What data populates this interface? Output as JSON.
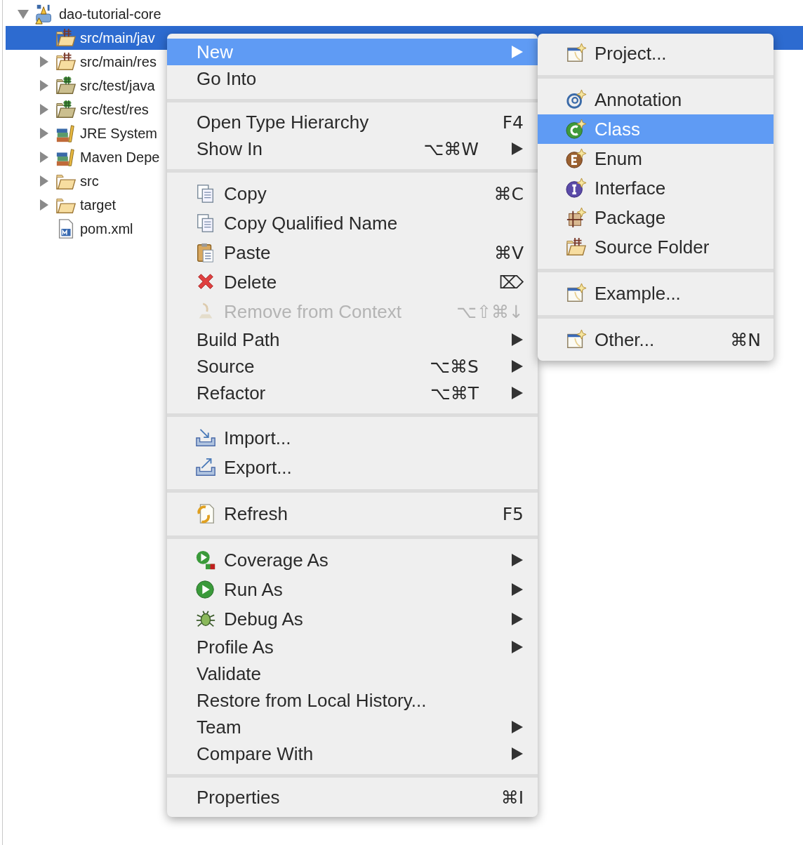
{
  "tree": {
    "label": "dao-tutorial-core",
    "kind": "project",
    "expanded": true,
    "selected": false,
    "children": [
      {
        "label": "src/main/jav",
        "kind": "sourcefolder",
        "selected": true
      },
      {
        "label": "src/main/res",
        "kind": "sourcefolder",
        "expanded": false,
        "selected": false
      },
      {
        "label": "src/test/java",
        "kind": "testfolder",
        "expanded": false,
        "selected": false
      },
      {
        "label": "src/test/res",
        "kind": "testfolder",
        "expanded": false,
        "selected": false
      },
      {
        "label": "JRE System",
        "kind": "library",
        "expanded": false,
        "selected": false
      },
      {
        "label": "Maven Depe",
        "kind": "library",
        "expanded": false,
        "selected": false
      },
      {
        "label": "src",
        "kind": "folder",
        "expanded": false,
        "selected": false
      },
      {
        "label": "target",
        "kind": "folder",
        "expanded": false,
        "selected": false
      },
      {
        "label": "pom.xml",
        "kind": "maven",
        "selected": false
      }
    ]
  },
  "context_menu": {
    "groups": [
      [
        {
          "label": "New",
          "kind": "plain",
          "submenu": true,
          "selected": true,
          "disabled": false
        },
        {
          "label": "Go Into",
          "kind": "plain",
          "submenu": false,
          "selected": false,
          "disabled": false
        }
      ],
      [
        {
          "label": "Open Type Hierarchy",
          "shortcut": "F4",
          "kind": "plain",
          "submenu": false,
          "selected": false,
          "disabled": false
        },
        {
          "label": "Show In",
          "shortcut": "⌥⌘W",
          "kind": "plain",
          "submenu": true,
          "selected": false,
          "disabled": false
        }
      ],
      [
        {
          "label": "Copy",
          "shortcut": "⌘C",
          "kind": "copy",
          "submenu": false,
          "selected": false,
          "disabled": false
        },
        {
          "label": "Copy Qualified Name",
          "kind": "copy",
          "submenu": false,
          "selected": false,
          "disabled": false
        },
        {
          "label": "Paste",
          "shortcut": "⌘V",
          "kind": "paste",
          "submenu": false,
          "selected": false,
          "disabled": false
        },
        {
          "label": "Delete",
          "shortcut": "⌦",
          "kind": "delete",
          "submenu": false,
          "selected": false,
          "disabled": false
        },
        {
          "label": "Remove from Context",
          "shortcut": "⌥⇧⌘↓",
          "kind": "remove",
          "submenu": false,
          "selected": false,
          "disabled": true
        },
        {
          "label": "Build Path",
          "kind": "plain",
          "submenu": true,
          "selected": false,
          "disabled": false
        },
        {
          "label": "Source",
          "shortcut": "⌥⌘S",
          "kind": "plain",
          "submenu": true,
          "selected": false,
          "disabled": false
        },
        {
          "label": "Refactor",
          "shortcut": "⌥⌘T",
          "kind": "plain",
          "submenu": true,
          "selected": false,
          "disabled": false
        }
      ],
      [
        {
          "label": "Import...",
          "kind": "import",
          "submenu": false,
          "selected": false,
          "disabled": false
        },
        {
          "label": "Export...",
          "kind": "export",
          "submenu": false,
          "selected": false,
          "disabled": false
        }
      ],
      [
        {
          "label": "Refresh",
          "shortcut": "F5",
          "kind": "refresh",
          "submenu": false,
          "selected": false,
          "disabled": false
        }
      ],
      [
        {
          "label": "Coverage As",
          "kind": "coverage",
          "submenu": true,
          "selected": false,
          "disabled": false
        },
        {
          "label": "Run As",
          "kind": "run",
          "submenu": true,
          "selected": false,
          "disabled": false
        },
        {
          "label": "Debug As",
          "kind": "debug",
          "submenu": true,
          "selected": false,
          "disabled": false
        },
        {
          "label": "Profile As",
          "kind": "plain",
          "submenu": true,
          "selected": false,
          "disabled": false
        },
        {
          "label": "Validate",
          "kind": "plain",
          "submenu": false,
          "selected": false,
          "disabled": false
        },
        {
          "label": "Restore from Local History...",
          "kind": "plain",
          "submenu": false,
          "selected": false,
          "disabled": false
        },
        {
          "label": "Team",
          "kind": "plain",
          "submenu": true,
          "selected": false,
          "disabled": false
        },
        {
          "label": "Compare With",
          "kind": "plain",
          "submenu": true,
          "selected": false,
          "disabled": false
        }
      ],
      [
        {
          "label": "Properties",
          "shortcut": "⌘I",
          "kind": "plain",
          "submenu": false,
          "selected": false,
          "disabled": false
        }
      ]
    ]
  },
  "new_submenu": {
    "groups": [
      [
        {
          "label": "Project...",
          "kind": "wizard",
          "selected": false
        }
      ],
      [
        {
          "label": "Annotation",
          "kind": "annotation",
          "selected": false
        },
        {
          "label": "Class",
          "kind": "class",
          "selected": true
        },
        {
          "label": "Enum",
          "kind": "enum",
          "selected": false
        },
        {
          "label": "Interface",
          "kind": "interface",
          "selected": false
        },
        {
          "label": "Package",
          "kind": "package",
          "selected": false
        },
        {
          "label": "Source Folder",
          "kind": "sourcefolder",
          "selected": false
        }
      ],
      [
        {
          "label": "Example...",
          "kind": "wizard",
          "selected": false
        }
      ],
      [
        {
          "label": "Other...",
          "shortcut": "⌘N",
          "kind": "wizard",
          "selected": false
        }
      ]
    ]
  }
}
